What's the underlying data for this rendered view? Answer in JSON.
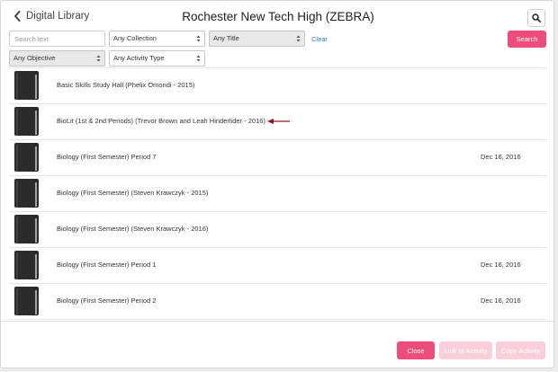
{
  "header": {
    "back_label": "Digital Library",
    "title": "Rochester New Tech High (ZEBRA)"
  },
  "filters": {
    "search_placeholder": "Search text",
    "collection": "Any Collection",
    "title": "Any Title",
    "objective": "Any Objective",
    "activity_type": "Any Activity Type",
    "clear_label": "Clear",
    "search_label": "Search"
  },
  "list": {
    "items": [
      {
        "name": "Basic Skills Study Hall (Phelix Omondi - 2015)",
        "date": ""
      },
      {
        "name": "BioLit (1st & 2nd Periods) (Trevor Brown and Leah Hinderlider - 2016)",
        "date": ""
      },
      {
        "name": "Biology (First Semester) Period 7",
        "date": "Dec 16, 2016"
      },
      {
        "name": "Biology (First Semester) (Steven Krawczyk - 2015)",
        "date": ""
      },
      {
        "name": "Biology (First Semester) (Steven Krawczyk - 2016)",
        "date": ""
      },
      {
        "name": "Biology (First Semester) Period 1",
        "date": "Dec 16, 2016"
      },
      {
        "name": "Biology (First Semester) Period 2",
        "date": "Dec 16, 2016"
      },
      {
        "name": "",
        "date": ""
      }
    ]
  },
  "footer": {
    "close_label": "Close",
    "link_label": "Link to Activity",
    "copy_label": "Copy Activity"
  },
  "icons": {
    "back": "chevron-left-icon",
    "search": "search-icon",
    "item": "book-icon",
    "annotation": "red-arrow-icon"
  },
  "colors": {
    "accent": "#ee4d7b",
    "accent_disabled": "#f9cfdb",
    "link": "#2a7fc4",
    "annotation_arrow": "#8b1a1a"
  }
}
